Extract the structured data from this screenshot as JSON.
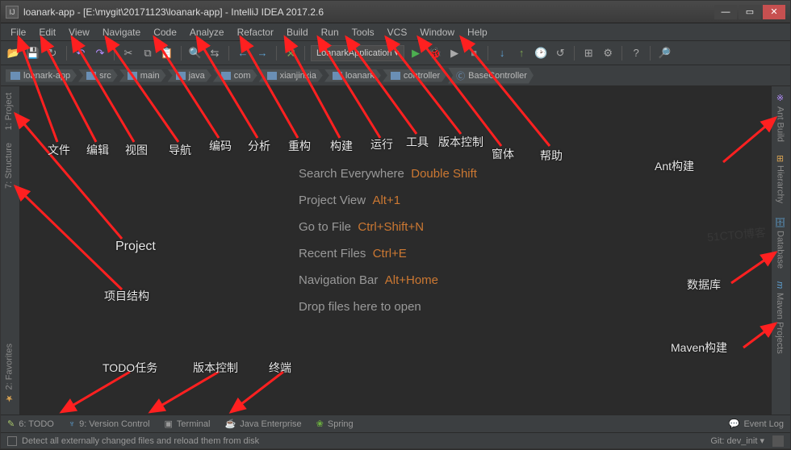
{
  "titlebar": {
    "icon_text": "IJ",
    "text": "loanark-app - [E:\\mygit\\20171123\\loanark-app] - IntelliJ IDEA 2017.2.6"
  },
  "menubar": [
    "File",
    "Edit",
    "View",
    "Navigate",
    "Code",
    "Analyze",
    "Refactor",
    "Build",
    "Run",
    "Tools",
    "VCS",
    "Window",
    "Help"
  ],
  "run_config": "LoanarkApplication ▾",
  "breadcrumb": [
    "loanark-app",
    "src",
    "main",
    "java",
    "com",
    "xianjinxia",
    "loanark",
    "controller",
    "BaseController"
  ],
  "welcome": {
    "l1a": "Search Everywhere",
    "l1b": "Double Shift",
    "l2a": "Project View",
    "l2b": "Alt+1",
    "l3a": "Go to File",
    "l3b": "Ctrl+Shift+N",
    "l4a": "Recent Files",
    "l4b": "Ctrl+E",
    "l5a": "Navigation Bar",
    "l5b": "Alt+Home",
    "l6": "Drop files here to open"
  },
  "left_tabs": {
    "project": "1: Project",
    "structure": "7: Structure",
    "favorites": "2: Favorites"
  },
  "right_tabs": {
    "ant": "Ant Build",
    "hierarchy": "Hierarchy",
    "database": "Database",
    "maven": "Maven Projects"
  },
  "bottom": {
    "todo": "6: TODO",
    "vcs": "9: Version Control",
    "terminal": "Terminal",
    "javaee": "Java Enterprise",
    "spring": "Spring",
    "eventlog": "Event Log"
  },
  "status": {
    "msg": "Detect all externally changed files and reload them from disk",
    "git": "Git: dev_init ▾"
  },
  "ann": {
    "file": "文件",
    "edit": "编辑",
    "view": "视图",
    "navigate": "导航",
    "code": "编码",
    "analyze": "分析",
    "refactor": "重构",
    "build": "构建",
    "run": "运行",
    "tools": "工具",
    "vcs": "版本控制",
    "window": "窗体",
    "help": "帮助",
    "project": "Project",
    "structure": "项目结构",
    "todo": "TODO任务",
    "vcs2": "版本控制",
    "terminal": "终端",
    "ant": "Ant构建",
    "database": "数据库",
    "maven": "Maven构建"
  }
}
